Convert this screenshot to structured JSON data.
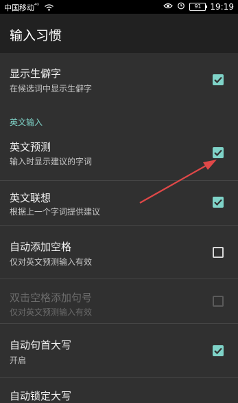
{
  "status_bar": {
    "carrier": "中国移动",
    "network": "⁴ᴳ",
    "battery": "91",
    "time": "19:19"
  },
  "header": {
    "title": "输入习惯"
  },
  "section": {
    "english_input": "英文输入"
  },
  "items": [
    {
      "title": "显示生僻字",
      "subtitle": "在候选词中显示生僻字",
      "checked": true,
      "enabled": true
    },
    {
      "title": "英文预测",
      "subtitle": "输入时显示建议的字词",
      "checked": true,
      "enabled": true
    },
    {
      "title": "英文联想",
      "subtitle": "根据上一个字词提供建议",
      "checked": true,
      "enabled": true
    },
    {
      "title": "自动添加空格",
      "subtitle": "仅对英文预测输入有效",
      "checked": false,
      "enabled": true
    },
    {
      "title": "双击空格添加句号",
      "subtitle": "仅对英文预测输入有效",
      "checked": false,
      "enabled": false
    },
    {
      "title": "自动句首大写",
      "subtitle": "开启",
      "checked": true,
      "enabled": true
    },
    {
      "title": "自动锁定大写",
      "subtitle": "",
      "checked": false,
      "enabled": true
    }
  ],
  "colors": {
    "accent": "#7fd3c8",
    "annotation_arrow": "#e04848",
    "background": "#303030",
    "app_bar": "#212121"
  },
  "icons": [
    "wifi-icon",
    "eye-icon",
    "alarm-icon",
    "battery-icon",
    "checkmark-icon",
    "annotation-arrow-icon"
  ]
}
